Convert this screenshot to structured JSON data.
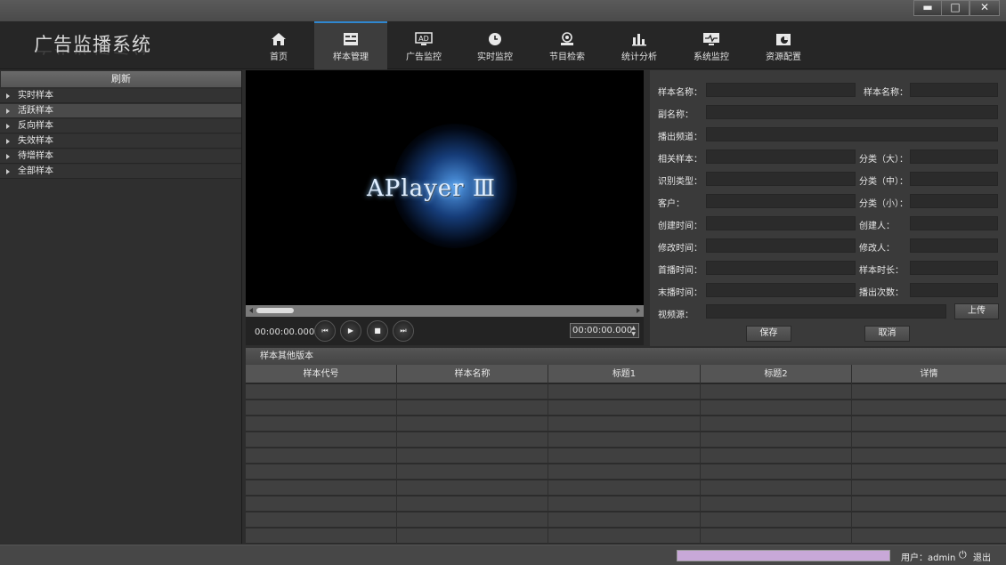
{
  "app": {
    "title": "广告监播系统"
  },
  "window_controls": {
    "minimize": "▬",
    "maximize": "□",
    "close": "✕"
  },
  "nav": [
    {
      "label": "首页",
      "icon": "home-icon"
    },
    {
      "label": "样本管理",
      "icon": "sample-manage-icon",
      "active": true
    },
    {
      "label": "广告监控",
      "icon": "ad-monitor-icon"
    },
    {
      "label": "实时监控",
      "icon": "clock-icon"
    },
    {
      "label": "节目检索",
      "icon": "search-person-icon"
    },
    {
      "label": "统计分析",
      "icon": "bar-chart-icon"
    },
    {
      "label": "系统监控",
      "icon": "system-monitor-icon"
    },
    {
      "label": "资源配置",
      "icon": "resource-config-icon"
    }
  ],
  "left_panel": {
    "refresh_label": "刷新",
    "items": [
      "实时样本",
      "活跃样本",
      "反向样本",
      "失效样本",
      "待增样本",
      "全部样本"
    ],
    "selected_index": 1
  },
  "player": {
    "logo_text": "APlayer Ⅲ",
    "time_left": "00:00:00.000",
    "time_right": "00:00:00.000",
    "buttons": [
      "previous-icon",
      "play-icon",
      "stop-icon",
      "next-icon"
    ]
  },
  "form": {
    "labels": {
      "name1": "样本名称：",
      "name2": "样本名称：",
      "subname": "副名称：",
      "channel": "播出频道：",
      "related": "相关样本：",
      "cat_big": "分类（大）：",
      "recog_type": "识别类型：",
      "cat_mid": "分类（中）：",
      "client": "客户：",
      "cat_small": "分类（小）：",
      "create_time": "创建时间：",
      "creator": "创建人：",
      "modify_time": "修改时间：",
      "modifier": "修改人：",
      "first_time": "首播时间：",
      "duration": "样本时长：",
      "last_time": "末播时间：",
      "play_count": "播出次数：",
      "video_source": "视频源："
    },
    "upload_label": "上传",
    "save_label": "保存",
    "cancel_label": "取消"
  },
  "versions": {
    "title": "样本其他版本",
    "columns": [
      "样本代号",
      "样本名称",
      "标题1",
      "标题2",
      "详情"
    ],
    "row_count": 10
  },
  "status": {
    "progress": 1.0,
    "progress_color": "#c8a8d8",
    "user_text": "用户：admin",
    "logout_label": "退出"
  },
  "colors": {
    "accent": "#2f87d0"
  }
}
